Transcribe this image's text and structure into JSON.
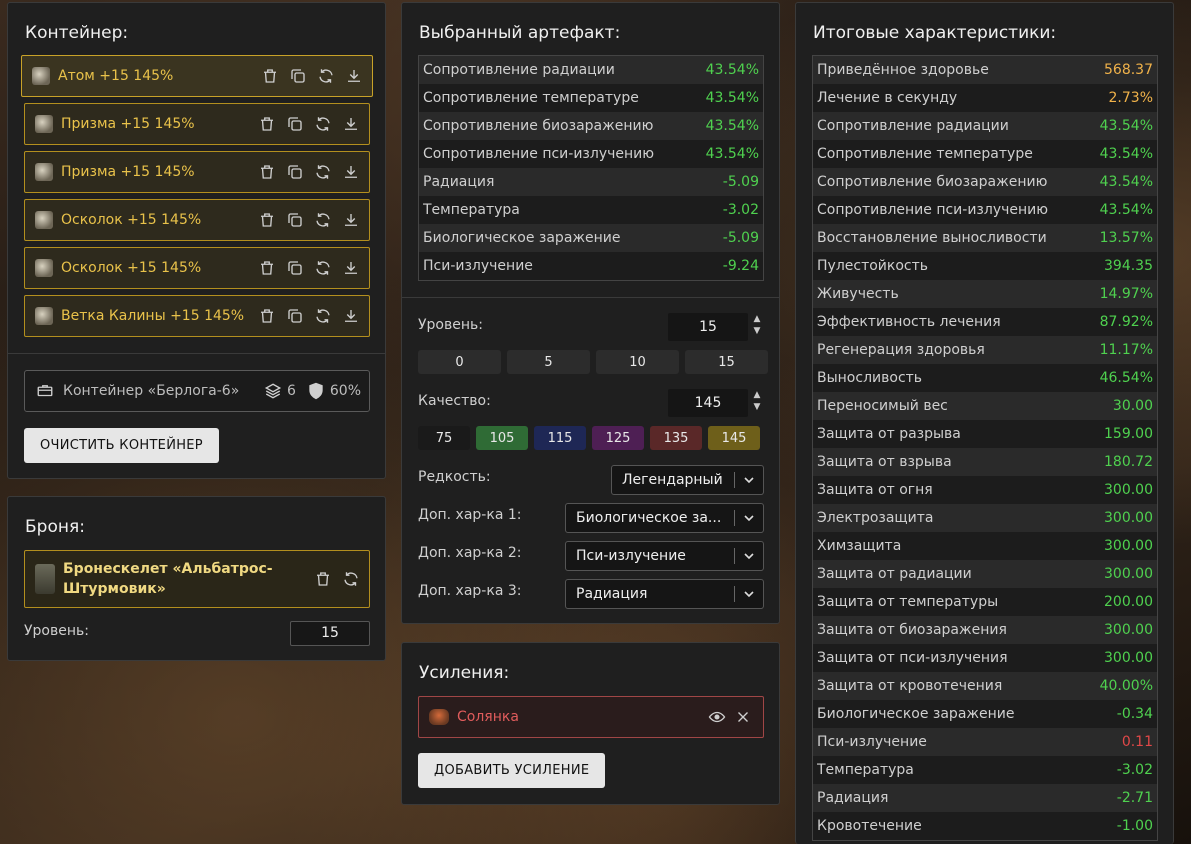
{
  "container": {
    "title": "Контейнер:",
    "artifacts": [
      {
        "name": "Атом +15 145%"
      },
      {
        "name": "Призма +15 145%"
      },
      {
        "name": "Призма +15 145%"
      },
      {
        "name": "Осколок +15 145%"
      },
      {
        "name": "Осколок +15 145%"
      },
      {
        "name": "Ветка Калины +15 145%"
      }
    ],
    "box_name": "Контейнер «Берлога-6»",
    "slots": "6",
    "protection": "60%",
    "clear_button": "ОЧИСТИТЬ КОНТЕЙНЕР"
  },
  "armor": {
    "title": "Броня:",
    "item_line1": "Бронескелет «Альбатрос-",
    "item_line2": "Штурмовик»",
    "level_label": "Уровень:",
    "level_value": "15"
  },
  "artifact": {
    "title": "Выбранный артефакт:",
    "stats": [
      {
        "k": "Сопротивление радиации",
        "v": "43.54%"
      },
      {
        "k": "Сопротивление температуре",
        "v": "43.54%"
      },
      {
        "k": "Сопротивление биозаражению",
        "v": "43.54%"
      },
      {
        "k": "Сопротивление пси-излучению",
        "v": "43.54%"
      },
      {
        "k": "Радиация",
        "v": "-5.09"
      },
      {
        "k": "Температура",
        "v": "-3.02"
      },
      {
        "k": "Биологическое заражение",
        "v": "-5.09"
      },
      {
        "k": "Пси-излучение",
        "v": "-9.24"
      }
    ],
    "level_label": "Уровень:",
    "level_value": "15",
    "level_presets": [
      "0",
      "5",
      "10",
      "15"
    ],
    "quality_label": "Качество:",
    "quality_value": "145",
    "quality_presets": [
      {
        "label": "75",
        "color": "#1a1a1a"
      },
      {
        "label": "105",
        "color": "#2f6b35"
      },
      {
        "label": "115",
        "color": "#1e2755"
      },
      {
        "label": "125",
        "color": "#4e1f54"
      },
      {
        "label": "135",
        "color": "#5a2828"
      },
      {
        "label": "145",
        "color": "#6e5f1a"
      }
    ],
    "rarity_label": "Редкость:",
    "rarity_value": "Легендарный",
    "extra1_label": "Доп. хар-ка 1:",
    "extra1_value": "Биологическое за...",
    "extra2_label": "Доп. хар-ка 2:",
    "extra2_value": "Пси-излучение",
    "extra3_label": "Доп. хар-ка 3:",
    "extra3_value": "Радиация"
  },
  "boosts": {
    "title": "Усиления:",
    "item": "Солянка",
    "add_button": "ДОБАВИТЬ УСИЛЕНИЕ"
  },
  "totals": {
    "title": "Итоговые характеристики:",
    "stats": [
      {
        "k": "Приведённое здоровье",
        "v": "568.37",
        "c": "gold"
      },
      {
        "k": "Лечение в секунду",
        "v": "2.73%",
        "c": "gold"
      },
      {
        "k": "Сопротивление радиации",
        "v": "43.54%",
        "c": ""
      },
      {
        "k": "Сопротивление температуре",
        "v": "43.54%",
        "c": ""
      },
      {
        "k": "Сопротивление биозаражению",
        "v": "43.54%",
        "c": ""
      },
      {
        "k": "Сопротивление пси-излучению",
        "v": "43.54%",
        "c": ""
      },
      {
        "k": "Восстановление выносливости",
        "v": "13.57%",
        "c": ""
      },
      {
        "k": "Пулестойкость",
        "v": "394.35",
        "c": ""
      },
      {
        "k": "Живучесть",
        "v": "14.97%",
        "c": ""
      },
      {
        "k": "Эффективность лечения",
        "v": "87.92%",
        "c": ""
      },
      {
        "k": "Регенерация здоровья",
        "v": "11.17%",
        "c": ""
      },
      {
        "k": "Выносливость",
        "v": "46.54%",
        "c": ""
      },
      {
        "k": "Переносимый вес",
        "v": "30.00",
        "c": ""
      },
      {
        "k": "Защита от разрыва",
        "v": "159.00",
        "c": ""
      },
      {
        "k": "Защита от взрыва",
        "v": "180.72",
        "c": ""
      },
      {
        "k": "Защита от огня",
        "v": "300.00",
        "c": ""
      },
      {
        "k": "Электрозащита",
        "v": "300.00",
        "c": ""
      },
      {
        "k": "Химзащита",
        "v": "300.00",
        "c": ""
      },
      {
        "k": "Защита от радиации",
        "v": "300.00",
        "c": ""
      },
      {
        "k": "Защита от температуры",
        "v": "200.00",
        "c": ""
      },
      {
        "k": "Защита от биозаражения",
        "v": "300.00",
        "c": ""
      },
      {
        "k": "Защита от пси-излучения",
        "v": "300.00",
        "c": ""
      },
      {
        "k": "Защита от кровотечения",
        "v": "40.00%",
        "c": ""
      },
      {
        "k": "Биологическое заражение",
        "v": "-0.34",
        "c": ""
      },
      {
        "k": "Пси-излучение",
        "v": "0.11",
        "c": "red"
      },
      {
        "k": "Температура",
        "v": "-3.02",
        "c": ""
      },
      {
        "k": "Радиация",
        "v": "-2.71",
        "c": ""
      },
      {
        "k": "Кровотечение",
        "v": "-1.00",
        "c": ""
      }
    ]
  }
}
